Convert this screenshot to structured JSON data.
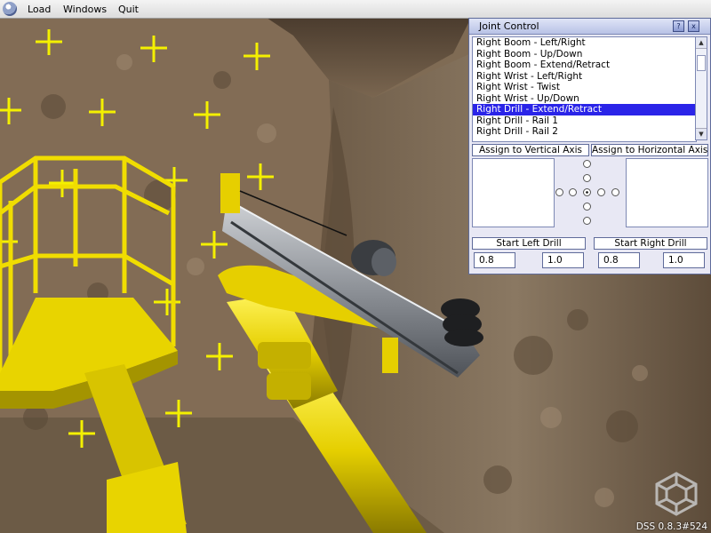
{
  "menubar": {
    "items": [
      {
        "label": "Load"
      },
      {
        "label": "Windows"
      },
      {
        "label": "Quit"
      }
    ]
  },
  "joint_window": {
    "title": "Joint Control",
    "titlebar_buttons": [
      "?",
      "x"
    ],
    "list": {
      "items": [
        "Right Boom - Left/Right",
        "Right Boom - Up/Down",
        "Right Boom - Extend/Retract",
        "Right Wrist - Left/Right",
        "Right Wrist - Twist",
        "Right Wrist - Up/Down",
        "Right Drill - Extend/Retract",
        "Right Drill - Rail 1",
        "Right Drill - Rail 2"
      ],
      "selected_index": 6
    },
    "assign_vertical_label": "Assign to Vertical Axis",
    "assign_horizontal_label": "Assign to Horizontal Axis",
    "start_left_drill_label": "Start Left Drill",
    "start_right_drill_label": "Start Right Drill",
    "left_drill_values": [
      "0.8",
      "1.0"
    ],
    "right_drill_values": [
      "0.8",
      "1.0"
    ]
  },
  "status": {
    "version": "DSS 0.8.3#524"
  },
  "colors": {
    "selection": "#2a24e8",
    "machine_yellow": "#e8d400",
    "rock": "#7a6650",
    "crosshair": "#f4f000"
  }
}
